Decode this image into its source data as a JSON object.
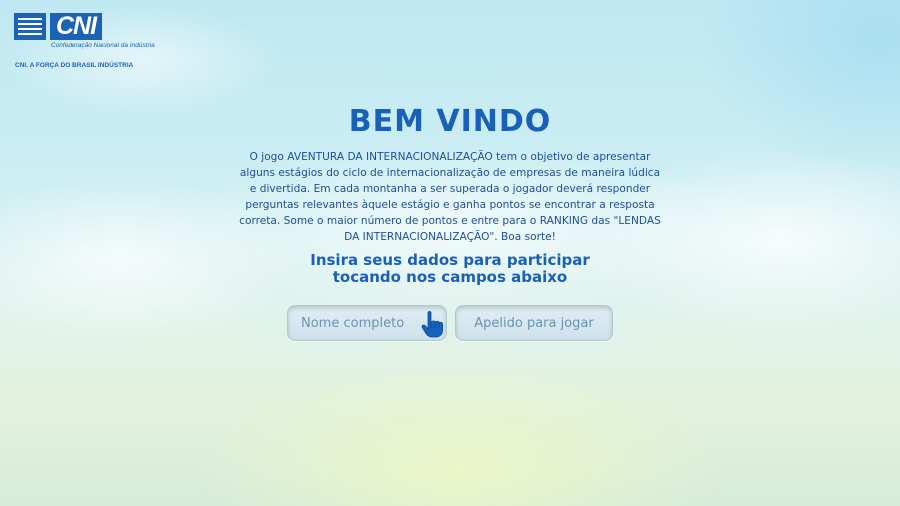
{
  "logo": {
    "brand": "CNI",
    "subtitle": "Confederação Nacional da Indústria",
    "tagline": "CNI. A FORÇA DO BRASIL INDÚSTRIA"
  },
  "welcome": {
    "title": "BEM VINDO",
    "description": "O jogo AVENTURA DA INTERNACIONALIZAÇÃO tem o objetivo de apresentar alguns estágios do ciclo de internacionalização de empresas de maneira lúdica e divertida. Em cada montanha a ser superada o jogador deverá responder perguntas relevantes àquele estágio e ganha pontos se encontrar a resposta correta. Some o maior número de pontos e entre para o RANKING das \"LENDAS DA INTERNACIONALIZAÇÃO\". Boa sorte!",
    "instruction_line1": "Insira seus dados para participar",
    "instruction_line2": "tocando nos campos abaixo"
  },
  "form": {
    "name_placeholder": "Nome completo",
    "nickname_placeholder": "Apelido para jogar"
  },
  "icons": {
    "logo_mark": "cni-emblem",
    "pointer": "pointing-hand-icon"
  },
  "colors": {
    "brand_blue": "#1860b8",
    "text_blue": "#1c4f9a",
    "field_text": "#6d93b4"
  }
}
